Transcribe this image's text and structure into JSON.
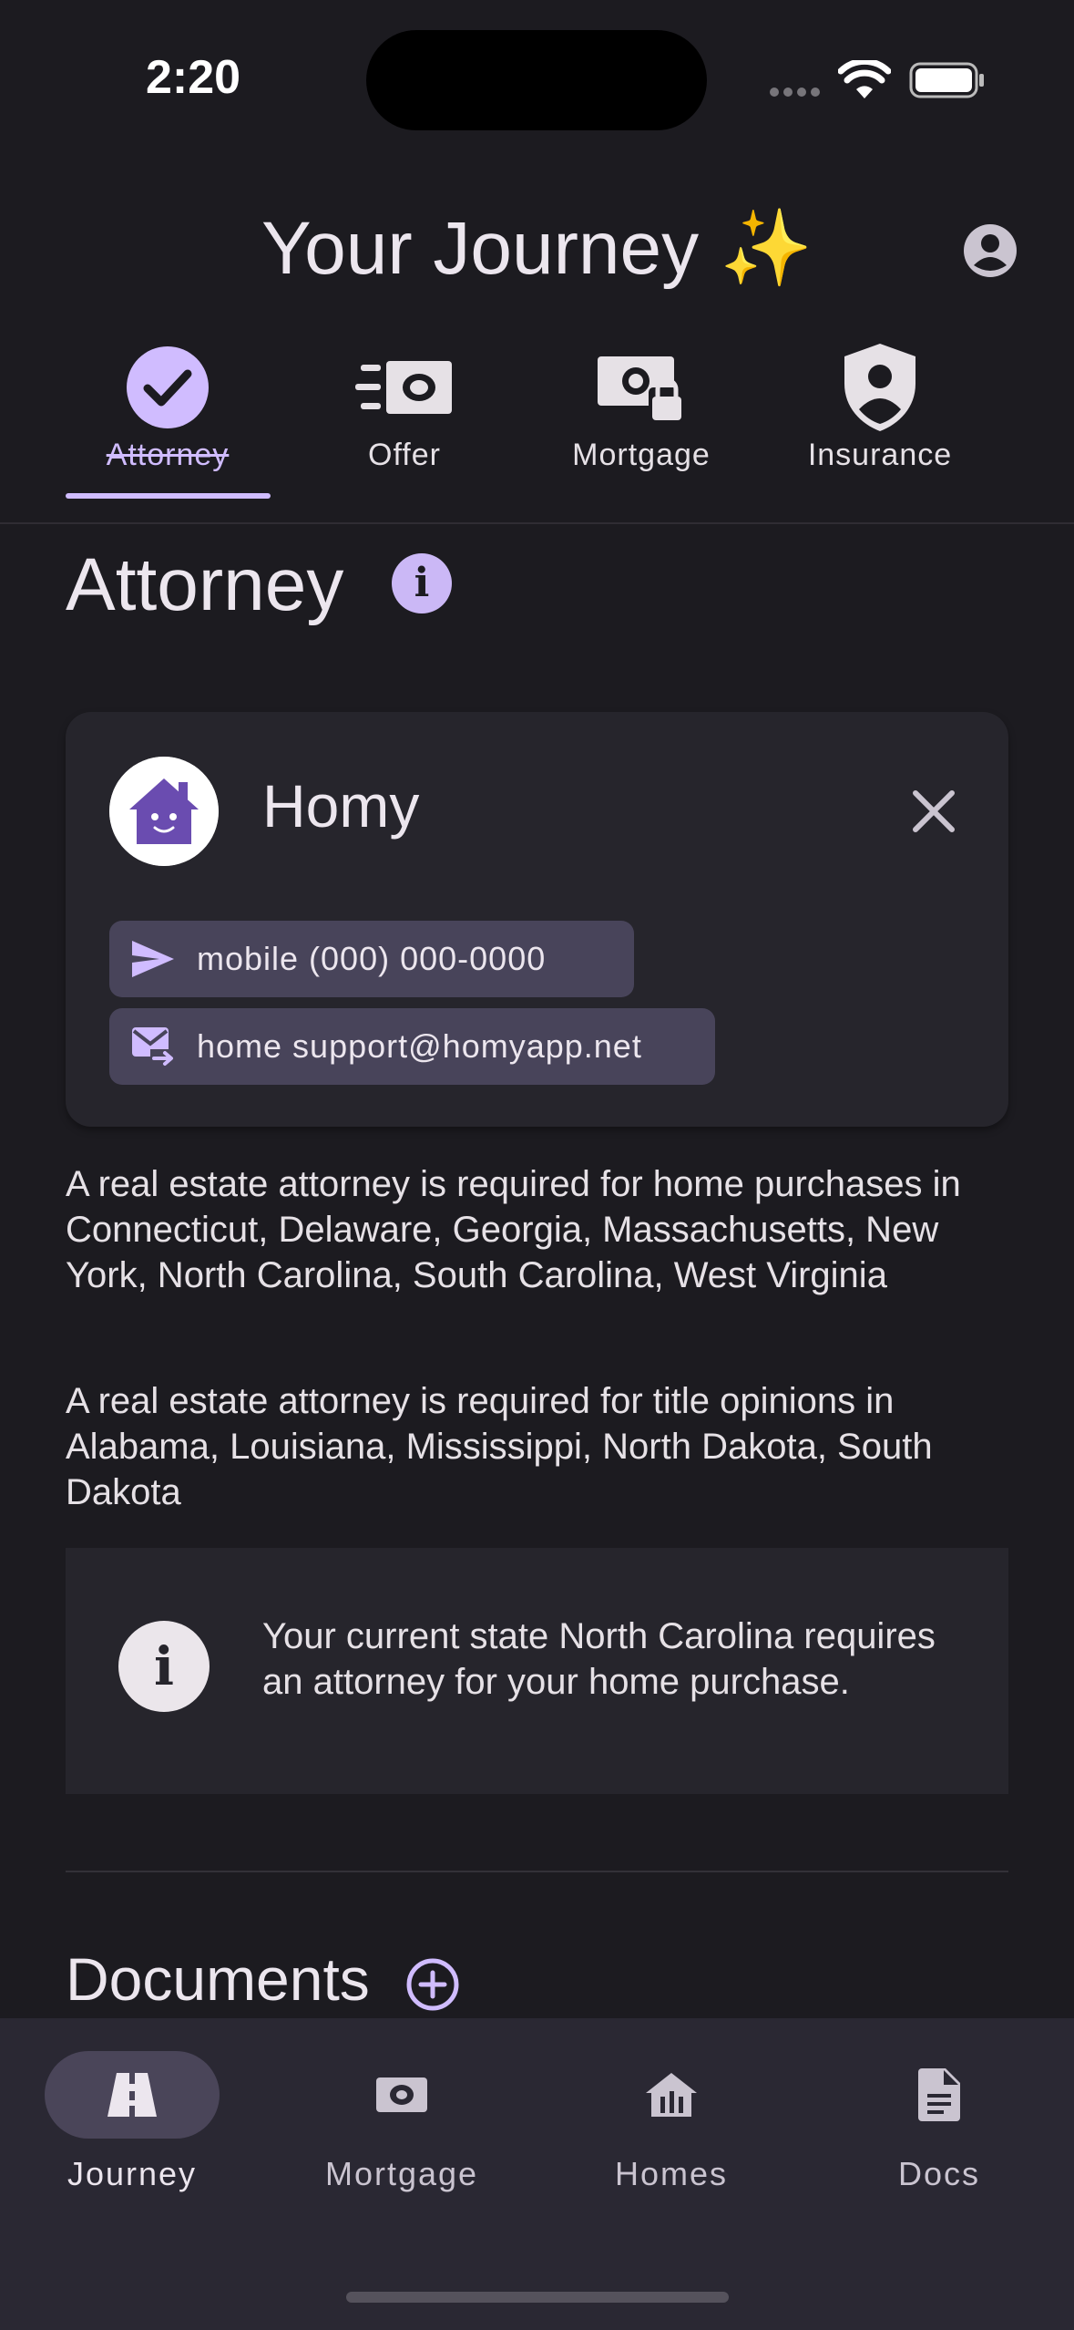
{
  "status": {
    "time": "2:20"
  },
  "header": {
    "title": "Your Journey",
    "sparkle": "✨"
  },
  "tabs": [
    {
      "label": "Attorney",
      "icon": "check-circle-icon",
      "active": true
    },
    {
      "label": "Offer",
      "icon": "money-send-icon",
      "active": false
    },
    {
      "label": "Mortgage",
      "icon": "money-lock-icon",
      "active": false
    },
    {
      "label": "Insurance",
      "icon": "shield-person-icon",
      "active": false
    }
  ],
  "section": {
    "title": "Attorney"
  },
  "card": {
    "company": "Homy",
    "phone_chip": "mobile (000) 000-0000",
    "email_chip": "home support@homyapp.net"
  },
  "paragraphs": {
    "p1": "A real estate attorney is required for home purchases in Connecticut, Delaware, Georgia, Massachusetts, New York, North Carolina, South Carolina, West Virginia",
    "p2": "A real estate attorney is required for title opinions in Alabama, Louisiana, Mississippi, North Dakota, South Dakota"
  },
  "notice": {
    "text": "Your current state North Carolina requires an attorney for your home purchase."
  },
  "documents": {
    "title": "Documents"
  },
  "bottom_nav": [
    {
      "label": "Journey",
      "icon": "road-icon",
      "active": true
    },
    {
      "label": "Mortgage",
      "icon": "money-icon",
      "active": false
    },
    {
      "label": "Homes",
      "icon": "house-icon",
      "active": false
    },
    {
      "label": "Docs",
      "icon": "document-icon",
      "active": false
    }
  ],
  "colors": {
    "accent": "#d0bcff",
    "background": "#1c1b20",
    "card": "#26252c",
    "chip": "#48445a",
    "brand": "#6a4cb0"
  }
}
